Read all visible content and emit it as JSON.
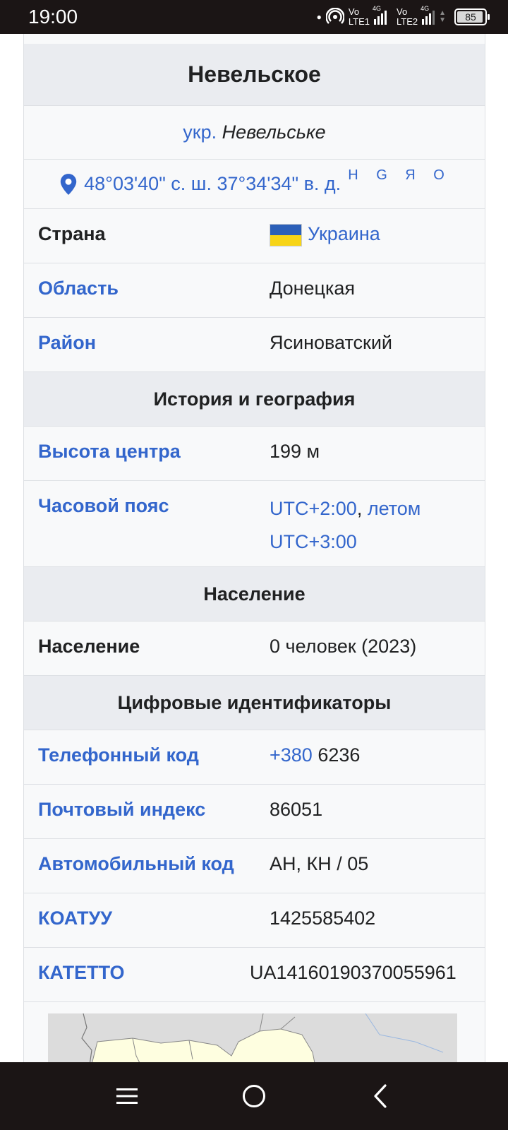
{
  "status": {
    "time": "19:00",
    "sim1_top": "Vo",
    "sim1_bottom": "LTE1",
    "sim1_net": "4G",
    "sim2_top": "Vo",
    "sim2_bottom": "LTE2",
    "sim2_net": "4G",
    "battery": "85"
  },
  "infobox": {
    "title": "Невельское",
    "ukr_prefix": "укр.",
    "ukr_name": "Невельське",
    "coordinates": "48°03'40\" с. ш. 37°34'34\" в. д.",
    "coord_links": "H G Я O",
    "country_label": "Страна",
    "country_value": "Украина",
    "region_label": "Область",
    "region_value": "Донецкая",
    "district_label": "Район",
    "district_value": "Ясиноватский",
    "section_history": "История и география",
    "elevation_label": "Высота центра",
    "elevation_value": "199 м",
    "timezone_label": "Часовой пояс",
    "timezone_value_1": "UTC+2:00",
    "timezone_sep": ", ",
    "timezone_value_2": "летом",
    "timezone_value_3": "UTC+3:00",
    "section_population": "Население",
    "population_label": "Население",
    "population_value": "0 человек (2023)",
    "section_ids": "Цифровые идентификаторы",
    "phone_label": "Телефонный код",
    "phone_value_link": "+380",
    "phone_value_rest": " 6236",
    "postal_label": "Почтовый индекс",
    "postal_value": "86051",
    "car_label": "Автомобильный код",
    "car_value": "АН, КН / 05",
    "koatuu_label": "КОАТУУ",
    "koatuu_value": "1425585402",
    "katetto_label": "КАТЕТТО",
    "katetto_value": "UA14160190370055961"
  },
  "colors": {
    "link": "#3366cc",
    "text": "#202122",
    "header_bg": "#eaecf0",
    "row_bg": "#f8f9fa"
  }
}
